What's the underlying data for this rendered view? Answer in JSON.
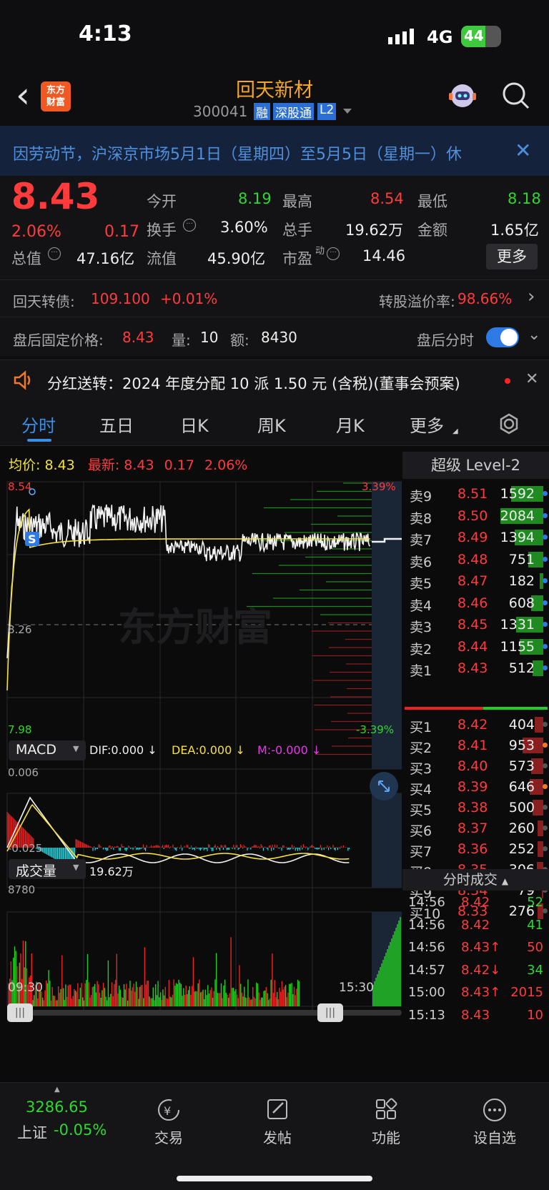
{
  "status": {
    "time": "4:13",
    "network": "4G",
    "battery": "44"
  },
  "header": {
    "back_label": "‹",
    "logo_line1": "东方",
    "logo_line2": "财富",
    "stock_name": "回天新材",
    "stock_code": "300041",
    "tags": [
      "融",
      "深股通",
      "L2"
    ]
  },
  "notice": {
    "text": "因劳动节，沪深京市场5月1日（星期四）至5月5日（星期一）休"
  },
  "quote": {
    "price": "8.43",
    "change_pct": "2.06%",
    "change": "0.17",
    "fields": [
      {
        "label": "今开",
        "value": "8.19",
        "color": "green"
      },
      {
        "label": "最高",
        "value": "8.54",
        "color": "red"
      },
      {
        "label": "最低",
        "value": "8.18",
        "color": "green"
      },
      {
        "label": "换手",
        "value": "3.60%",
        "color": "white"
      },
      {
        "label": "总手",
        "value": "19.62万",
        "color": "white"
      },
      {
        "label": "金额",
        "value": "1.65亿",
        "color": "white"
      },
      {
        "label": "总值",
        "value": "47.16亿",
        "color": "white"
      },
      {
        "label": "流值",
        "value": "45.90亿",
        "color": "white"
      },
      {
        "label": "市盈",
        "value": "14.46",
        "color": "white"
      }
    ],
    "pe_sup": "动",
    "more_button": "更多"
  },
  "bond": {
    "label": "回天转债:",
    "price": "109.100",
    "change": "+0.01%",
    "premium_label": "转股溢价率:",
    "premium": "98.66%"
  },
  "afterhours": {
    "label": "盘后固定价格:",
    "price": "8.43",
    "vol_label": "量:",
    "vol": "10",
    "amt_label": "额:",
    "amt": "8430",
    "toggle_label": "盘后分时"
  },
  "dividend": {
    "text": "分红送转：2024 年度分配 10 派 1.50 元 (含税)(董事会预案)"
  },
  "tabs": [
    "分时",
    "五日",
    "日K",
    "周K",
    "月K",
    "更多"
  ],
  "avg_line": {
    "avg_label": "均价:",
    "avg": "8.43",
    "last_label": "最新:",
    "last": "8.43",
    "chg": "0.17",
    "pct": "2.06%"
  },
  "price_axis": {
    "high": "8.54",
    "mid": "8.26",
    "low": "7.98",
    "pct_high": "3.39%",
    "pct_low": "-3.39%"
  },
  "watermark": "东方财富",
  "macd": {
    "name": "MACD",
    "dif": "DIF:0.000 ↓",
    "dea": "DEA:0.000 ↓",
    "m": "M:-0.000 ↓",
    "top": "0.006",
    "bottom": "-0.025"
  },
  "volume": {
    "name": "成交量",
    "total": "19.62万",
    "top": "8780"
  },
  "time_axis": {
    "start": "09:30",
    "end": "15:30"
  },
  "level2": {
    "title": "超级 Level-2",
    "asks": [
      {
        "label": "卖9",
        "price": "8.51",
        "vol": "1592"
      },
      {
        "label": "卖8",
        "price": "8.50",
        "vol": "2084"
      },
      {
        "label": "卖7",
        "price": "8.49",
        "vol": "1394"
      },
      {
        "label": "卖6",
        "price": "8.48",
        "vol": "751"
      },
      {
        "label": "卖5",
        "price": "8.47",
        "vol": "182"
      },
      {
        "label": "卖4",
        "price": "8.46",
        "vol": "608"
      },
      {
        "label": "卖3",
        "price": "8.45",
        "vol": "1331"
      },
      {
        "label": "卖2",
        "price": "8.44",
        "vol": "1155"
      },
      {
        "label": "卖1",
        "price": "8.43",
        "vol": "512"
      }
    ],
    "bids": [
      {
        "label": "买1",
        "price": "8.42",
        "vol": "404"
      },
      {
        "label": "买2",
        "price": "8.41",
        "vol": "953"
      },
      {
        "label": "买3",
        "price": "8.40",
        "vol": "573"
      },
      {
        "label": "买4",
        "price": "8.39",
        "vol": "646"
      },
      {
        "label": "买5",
        "price": "8.38",
        "vol": "500"
      },
      {
        "label": "买6",
        "price": "8.37",
        "vol": "260"
      },
      {
        "label": "买7",
        "price": "8.36",
        "vol": "252"
      },
      {
        "label": "买8",
        "price": "8.35",
        "vol": "306"
      },
      {
        "label": "买9",
        "price": "8.34",
        "vol": "79"
      },
      {
        "label": "买10",
        "price": "8.33",
        "vol": "276"
      }
    ]
  },
  "trades": {
    "title": "分时成交",
    "rows": [
      {
        "time": "14:56",
        "price": "8.42",
        "vol": "52",
        "pc": "red",
        "vc": "green"
      },
      {
        "time": "14:56",
        "price": "8.42",
        "vol": "41",
        "pc": "red",
        "vc": "green"
      },
      {
        "time": "14:56",
        "price": "8.43↑",
        "vol": "50",
        "pc": "red",
        "vc": "red"
      },
      {
        "time": "14:57",
        "price": "8.42↓",
        "vol": "34",
        "pc": "red",
        "vc": "green"
      },
      {
        "time": "15:00",
        "price": "8.43↑",
        "vol": "2015",
        "pc": "red",
        "vc": "red"
      },
      {
        "time": "15:13",
        "price": "8.43",
        "vol": "10",
        "pc": "red",
        "vc": "red"
      }
    ]
  },
  "bottom": {
    "index_value": "3286.65",
    "index_name": "上证",
    "index_change": "-0.05%",
    "items": [
      "交易",
      "发帖",
      "功能",
      "设自选"
    ]
  },
  "colors": {
    "up": "#ff3b3b",
    "down": "#2ed82e",
    "avg": "#f5e13b",
    "accent": "#3a8ee6"
  }
}
